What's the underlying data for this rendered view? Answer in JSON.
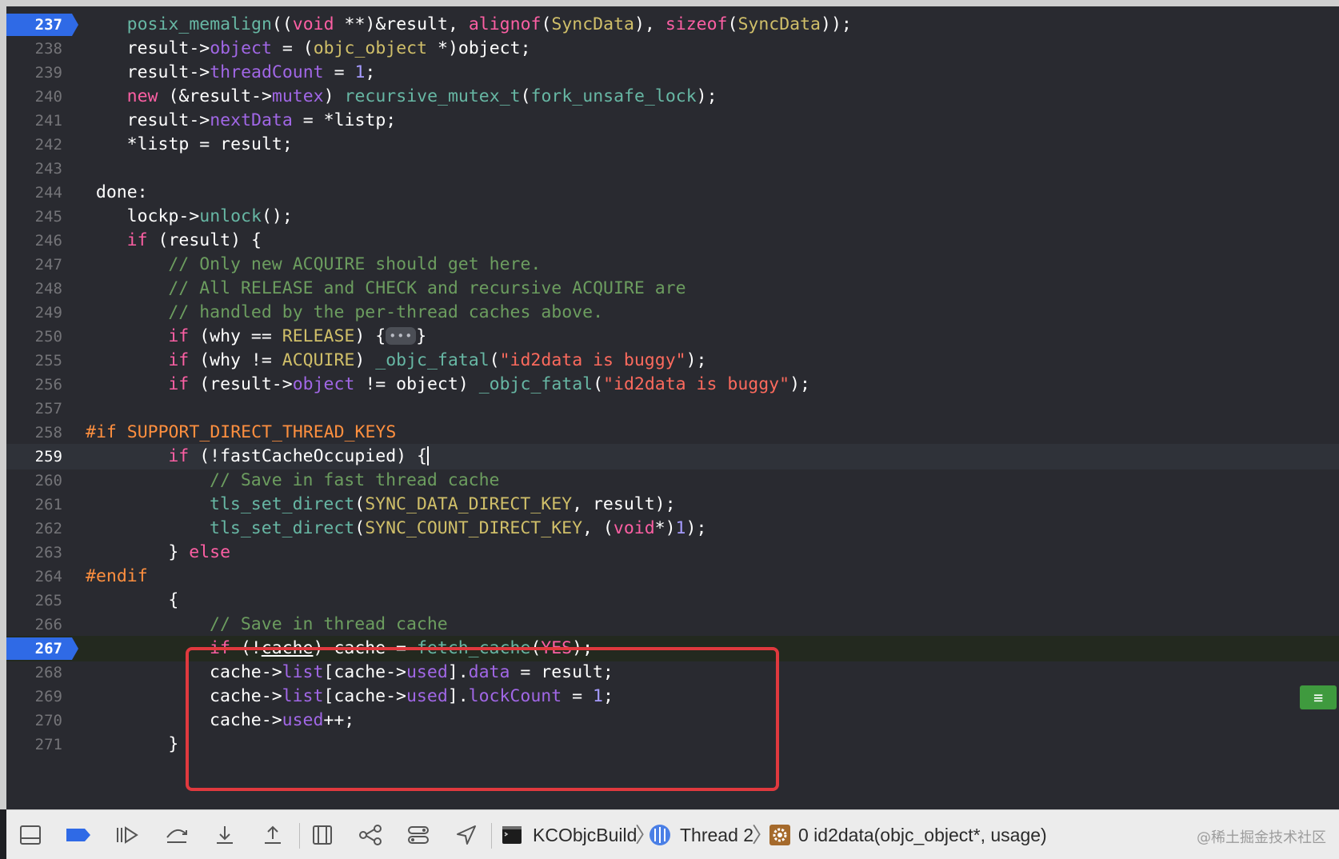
{
  "editor": {
    "current_line_number": "259",
    "program_counter_line_number": "267",
    "fold_placeholder": "•••",
    "lines": [
      {
        "num": "237",
        "indent": 4,
        "segs": [
          [
            "fn",
            "posix_memalign"
          ],
          [
            "",
            "(("
          ],
          [
            "kw",
            "void"
          ],
          [
            "",
            " **)&result, "
          ],
          [
            "kw",
            "alignof"
          ],
          [
            "",
            "("
          ],
          [
            "ac",
            "SyncData"
          ],
          [
            "",
            "), "
          ],
          [
            "kw",
            "sizeof"
          ],
          [
            "",
            "("
          ],
          [
            "ac",
            "SyncData"
          ],
          [
            "",
            "));"
          ]
        ]
      },
      {
        "num": "238",
        "indent": 4,
        "segs": [
          [
            "",
            "result->"
          ],
          [
            "pr",
            "object"
          ],
          [
            "",
            " = ("
          ],
          [
            "ac",
            "objc_object"
          ],
          [
            "",
            " *)object;"
          ]
        ]
      },
      {
        "num": "239",
        "indent": 4,
        "segs": [
          [
            "",
            "result->"
          ],
          [
            "pr",
            "threadCount"
          ],
          [
            "",
            " = "
          ],
          [
            "num",
            "1"
          ],
          [
            "",
            ";"
          ]
        ]
      },
      {
        "num": "240",
        "indent": 4,
        "segs": [
          [
            "kw",
            "new"
          ],
          [
            "",
            " (&result->"
          ],
          [
            "pr",
            "mutex"
          ],
          [
            "",
            ") "
          ],
          [
            "fn",
            "recursive_mutex_t"
          ],
          [
            "",
            "("
          ],
          [
            "fn",
            "fork_unsafe_lock"
          ],
          [
            "",
            ");"
          ]
        ]
      },
      {
        "num": "241",
        "indent": 4,
        "segs": [
          [
            "",
            "result->"
          ],
          [
            "pr",
            "nextData"
          ],
          [
            "",
            " = *listp;"
          ]
        ]
      },
      {
        "num": "242",
        "indent": 4,
        "segs": [
          [
            "",
            "*listp = result;"
          ]
        ]
      },
      {
        "num": "243",
        "indent": 0,
        "segs": []
      },
      {
        "num": "244",
        "indent": 1,
        "segs": [
          [
            "",
            "done:"
          ]
        ]
      },
      {
        "num": "245",
        "indent": 4,
        "segs": [
          [
            "",
            "lockp->"
          ],
          [
            "fn",
            "unlock"
          ],
          [
            "",
            "();"
          ]
        ]
      },
      {
        "num": "246",
        "indent": 4,
        "segs": [
          [
            "kw",
            "if"
          ],
          [
            "",
            " (result) {"
          ]
        ]
      },
      {
        "num": "247",
        "indent": 8,
        "segs": [
          [
            "cm",
            "// Only new ACQUIRE should get here."
          ]
        ]
      },
      {
        "num": "248",
        "indent": 8,
        "segs": [
          [
            "cm",
            "// All RELEASE and CHECK and recursive ACQUIRE are"
          ]
        ]
      },
      {
        "num": "249",
        "indent": 8,
        "segs": [
          [
            "cm",
            "// handled by the per-thread caches above."
          ]
        ]
      },
      {
        "num": "250",
        "indent": 8,
        "segs": [
          [
            "kw",
            "if"
          ],
          [
            "",
            " (why == "
          ],
          [
            "ac",
            "RELEASE"
          ],
          [
            "",
            ") {"
          ],
          [
            "fold",
            ""
          ],
          [
            "",
            "}"
          ]
        ]
      },
      {
        "num": "255",
        "indent": 8,
        "segs": [
          [
            "kw",
            "if"
          ],
          [
            "",
            " (why != "
          ],
          [
            "ac",
            "ACQUIRE"
          ],
          [
            "",
            ") "
          ],
          [
            "fn",
            "_objc_fatal"
          ],
          [
            "",
            "("
          ],
          [
            "st",
            "\"id2data is buggy\""
          ],
          [
            "",
            ");"
          ]
        ]
      },
      {
        "num": "256",
        "indent": 8,
        "segs": [
          [
            "kw",
            "if"
          ],
          [
            "",
            " (result->"
          ],
          [
            "pr",
            "object"
          ],
          [
            "",
            " != object) "
          ],
          [
            "fn",
            "_objc_fatal"
          ],
          [
            "",
            "("
          ],
          [
            "st",
            "\"id2data is buggy\""
          ],
          [
            "",
            ");"
          ]
        ]
      },
      {
        "num": "257",
        "indent": 0,
        "segs": []
      },
      {
        "num": "258",
        "indent": 0,
        "segs": [
          [
            "mc",
            "#if SUPPORT_DIRECT_THREAD_KEYS"
          ]
        ]
      },
      {
        "num": "259",
        "indent": 8,
        "segs": [
          [
            "kw",
            "if"
          ],
          [
            "",
            " (!fastCacheOccupied) {"
          ],
          [
            "cursor",
            ""
          ]
        ]
      },
      {
        "num": "260",
        "indent": 12,
        "segs": [
          [
            "cm",
            "// Save in fast thread cache"
          ]
        ]
      },
      {
        "num": "261",
        "indent": 12,
        "segs": [
          [
            "fn",
            "tls_set_direct"
          ],
          [
            "",
            "("
          ],
          [
            "ac",
            "SYNC_DATA_DIRECT_KEY"
          ],
          [
            "",
            ", result);"
          ]
        ]
      },
      {
        "num": "262",
        "indent": 12,
        "segs": [
          [
            "fn",
            "tls_set_direct"
          ],
          [
            "",
            "("
          ],
          [
            "ac",
            "SYNC_COUNT_DIRECT_KEY"
          ],
          [
            "",
            ", ("
          ],
          [
            "kw",
            "void"
          ],
          [
            "",
            "*)"
          ],
          [
            "num",
            "1"
          ],
          [
            "",
            ");"
          ]
        ]
      },
      {
        "num": "263",
        "indent": 8,
        "segs": [
          [
            "",
            "} "
          ],
          [
            "kw",
            "else"
          ]
        ]
      },
      {
        "num": "264",
        "indent": 0,
        "segs": [
          [
            "mc",
            "#endif"
          ]
        ]
      },
      {
        "num": "265",
        "indent": 8,
        "segs": [
          [
            "",
            "{"
          ]
        ]
      },
      {
        "num": "266",
        "indent": 12,
        "segs": [
          [
            "cm",
            "// Save in thread cache"
          ]
        ]
      },
      {
        "num": "267",
        "indent": 12,
        "segs": [
          [
            "kw",
            "if"
          ],
          [
            "",
            " (!"
          ],
          [
            "ul",
            "cache"
          ],
          [
            "",
            ") cache = "
          ],
          [
            "fn",
            "fetch_cache"
          ],
          [
            "",
            "("
          ],
          [
            "kw",
            "YES"
          ],
          [
            "",
            ");"
          ]
        ]
      },
      {
        "num": "268",
        "indent": 12,
        "segs": [
          [
            "",
            "cache->"
          ],
          [
            "pr",
            "list"
          ],
          [
            "",
            "[cache->"
          ],
          [
            "pr",
            "used"
          ],
          [
            "",
            "]."
          ],
          [
            "pr",
            "data"
          ],
          [
            "",
            " = result;"
          ]
        ]
      },
      {
        "num": "269",
        "indent": 12,
        "segs": [
          [
            "",
            "cache->"
          ],
          [
            "pr",
            "list"
          ],
          [
            "",
            "[cache->"
          ],
          [
            "pr",
            "used"
          ],
          [
            "",
            "]."
          ],
          [
            "pr",
            "lockCount"
          ],
          [
            "",
            " = "
          ],
          [
            "num",
            "1"
          ],
          [
            "",
            ";"
          ]
        ]
      },
      {
        "num": "270",
        "indent": 12,
        "segs": [
          [
            "",
            "cache->"
          ],
          [
            "pr",
            "used"
          ],
          [
            "",
            "++;"
          ]
        ]
      },
      {
        "num": "271",
        "indent": 8,
        "segs": [
          [
            "",
            "}"
          ]
        ]
      }
    ]
  },
  "debug_bar": {
    "target": "KCObjcBuild",
    "thread": "Thread 2",
    "frame": "0 id2data(objc_object*, usage)",
    "watermark": "@稀土掘金技术社区"
  },
  "icons": [
    "hide-debug-area-icon",
    "breakpoints-toggle-icon",
    "continue-icon",
    "step-over-icon",
    "step-into-icon",
    "step-out-icon",
    "debug-view-hierarchy-icon",
    "memory-graph-icon",
    "environment-overrides-icon",
    "simulate-location-icon",
    "terminal-app-icon",
    "thread-icon",
    "gear-icon"
  ],
  "colors": {
    "editor_background": "#292a30",
    "keyword": "#fc5fa3",
    "comment": "#6c9d5f",
    "function": "#67b7a4",
    "property": "#a167e6",
    "string": "#fc6a5d",
    "breakpoint": "#2f6ae6",
    "highlight_box": "#e0393e"
  }
}
